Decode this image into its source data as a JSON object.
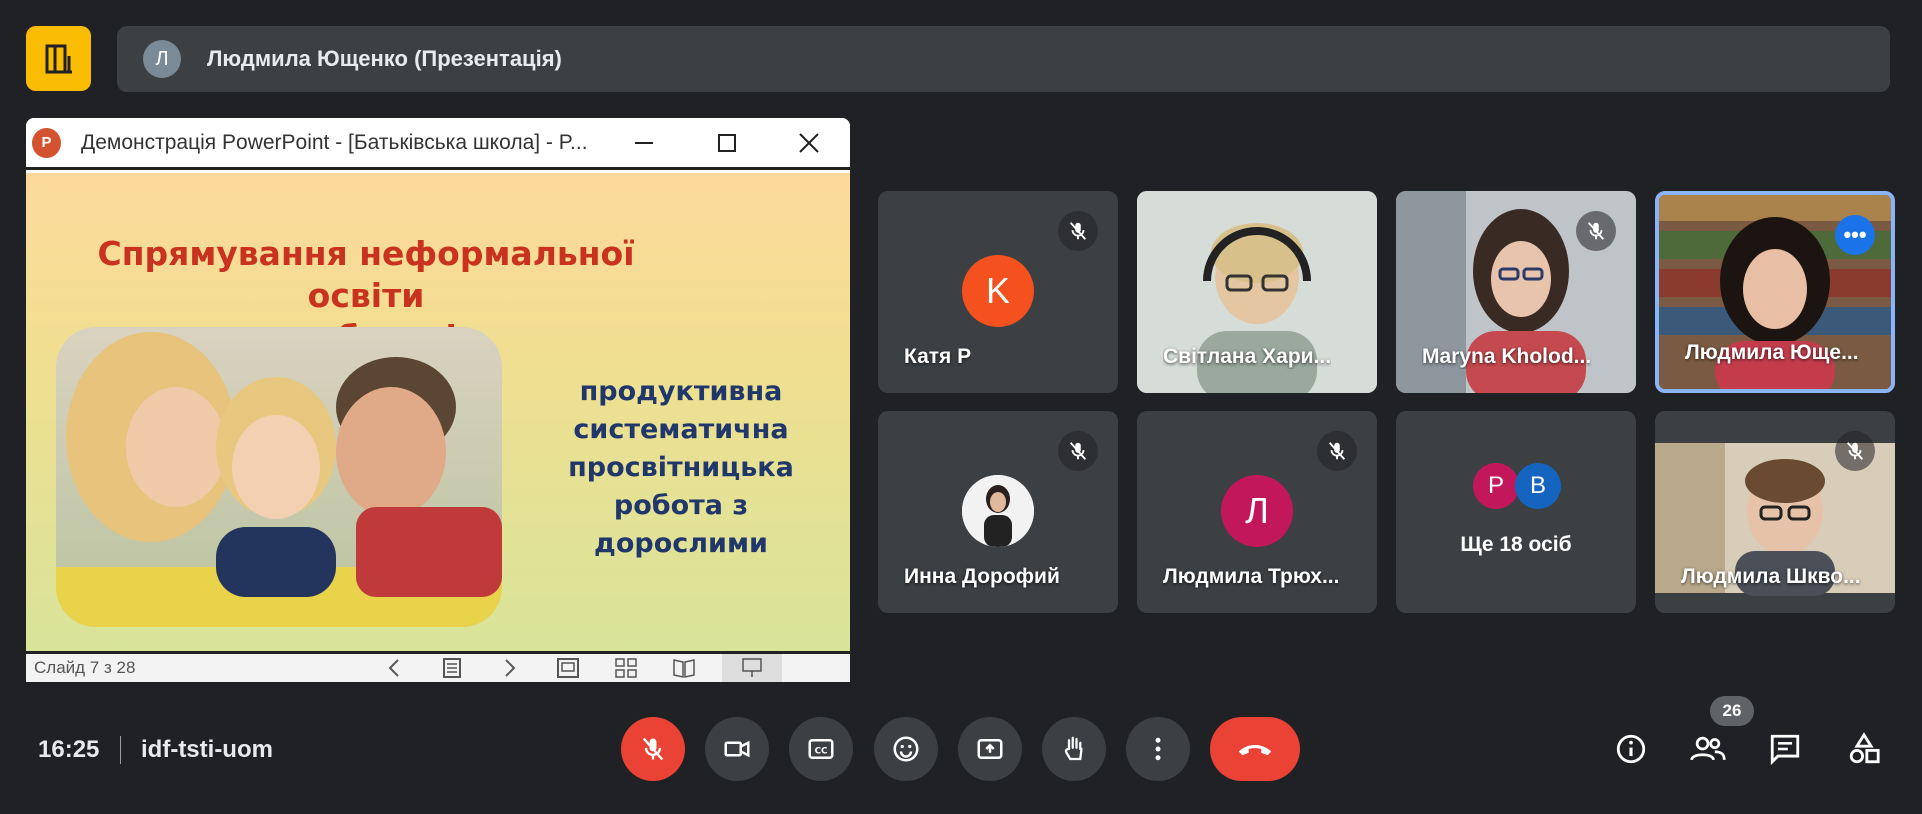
{
  "top": {
    "avatar_letter": "Л",
    "presenter_title": "Людмила Ющенко (Презентація)"
  },
  "ppt": {
    "logo_letter": "P",
    "window_title": "Демонстрація PowerPoint - [Батьківська школа] - P...",
    "slide_title_line1": "Спрямування неформальної освіти",
    "slide_title_line2": "для батьків",
    "slide_text": [
      "продуктивна",
      "систематична",
      "просвітницька",
      "робота з",
      "дорослими"
    ],
    "status": "Слайд 7 з 28"
  },
  "participants": [
    {
      "name": "Катя Р",
      "avatar_letter": "K",
      "avatar_color": "#f4511e",
      "muted": true
    },
    {
      "name": "Світлана Хари...",
      "muted": false
    },
    {
      "name": "Maryna Kholod...",
      "muted": true
    },
    {
      "name": "Людмила Юще...",
      "muted": false,
      "highlighted": true
    },
    {
      "name": "Инна Дорофий",
      "muted": true
    },
    {
      "name": "Людмила Трюх...",
      "avatar_letter": "Л",
      "avatar_color": "#c2185b",
      "muted": true
    },
    {
      "name": "Людмила Шкво...",
      "muted": true
    }
  ],
  "more_tile": {
    "avatars": [
      {
        "letter": "P",
        "color": "#c2185b"
      },
      {
        "letter": "B",
        "color": "#1565c0"
      }
    ],
    "label": "Ще 18 осіб"
  },
  "bottom": {
    "time": "16:25",
    "meeting_code": "idf-tsti-uom",
    "participant_count": "26"
  },
  "colors": {
    "background": "#202124",
    "tile": "#3c4043",
    "danger": "#ea4335",
    "highlight": "#8ab4f8",
    "logo": "#fbbc04"
  }
}
